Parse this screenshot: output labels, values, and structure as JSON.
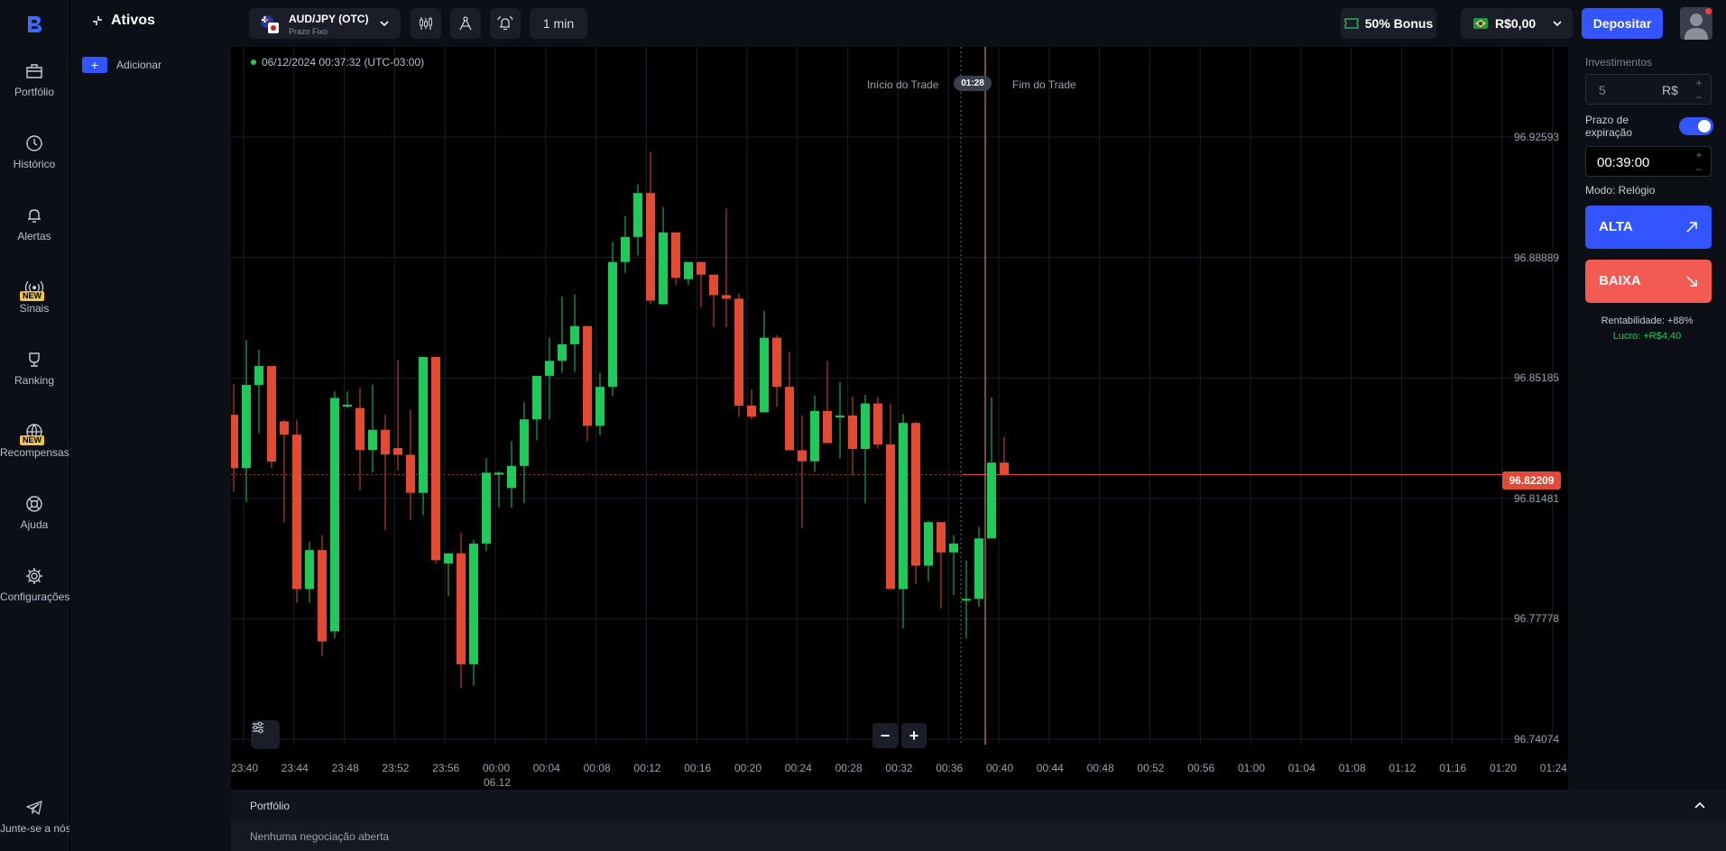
{
  "sidebar": {
    "logo": "brand-logo",
    "items": [
      {
        "label": "Portfólio",
        "icon": "briefcase-icon"
      },
      {
        "label": "Histórico",
        "icon": "clock-icon"
      },
      {
        "label": "Alertas",
        "icon": "bell-icon"
      },
      {
        "label": "Sinais",
        "icon": "signal-icon",
        "badge": "NEW"
      },
      {
        "label": "Ranking",
        "icon": "trophy-icon"
      },
      {
        "label": "Recompensas",
        "icon": "globe-icon",
        "badge": "NEW"
      },
      {
        "label": "Ajuda",
        "icon": "lifebuoy-icon"
      },
      {
        "label": "Configurações",
        "icon": "gear-icon"
      }
    ],
    "join": {
      "label": "Junte-se a nós",
      "icon": "telegram-icon"
    }
  },
  "assets_panel": {
    "title": "Ativos",
    "add_label": "Adicionar",
    "add_symbol": "+"
  },
  "topbar": {
    "asset": {
      "name": "AUD/JPY (OTC)",
      "subtitle": "Prazo Fixo"
    },
    "timeframe": "1 min",
    "bonus": "50% Bonus",
    "balance": "R$0,00",
    "deposit": "Depositar"
  },
  "chart": {
    "datetime": "06/12/2024 00:37:32 (UTC-03:00)",
    "trade_start": "Início do Trade",
    "trade_end": "Fim do Trade",
    "countdown": "01:28",
    "current_price": "96.82209",
    "y_ticks": [
      "96.92593",
      "96.88889",
      "96.85185",
      "96.81481",
      "96.77778",
      "96.74074"
    ],
    "x_ticks": [
      "23:40",
      "23:44",
      "23:48",
      "23:52",
      "23:56",
      "00:00",
      "00:04",
      "00:08",
      "00:12",
      "00:16",
      "00:20",
      "00:24",
      "00:28",
      "00:32",
      "00:36",
      "00:40",
      "00:44",
      "00:48",
      "00:52",
      "00:56",
      "01:00",
      "01:04",
      "01:08",
      "01:12",
      "01:16",
      "01:20",
      "01:24"
    ],
    "date_label": "06.12",
    "zoom_out": "−",
    "zoom_in": "+",
    "colors": {
      "up": "#21c85a",
      "down": "#e24a33",
      "grid": "#1b1e2a"
    },
    "candles": [
      [
        96.8405,
        96.85,
        96.8168,
        96.8241
      ],
      [
        96.8241,
        96.8635,
        96.8136,
        96.8497
      ],
      [
        96.8497,
        96.8604,
        96.8348,
        96.8555
      ],
      [
        96.8555,
        96.8555,
        96.8241,
        96.8261
      ],
      [
        96.8385,
        96.839,
        96.8075,
        96.8344
      ],
      [
        96.8344,
        96.839,
        96.7827,
        96.7869
      ],
      [
        96.7869,
        96.8014,
        96.7827,
        96.7989
      ],
      [
        96.7989,
        96.8035,
        96.7662,
        96.7708
      ],
      [
        96.7739,
        96.8477,
        96.7718,
        96.8457
      ],
      [
        96.8436,
        96.8477,
        96.8426,
        96.8436
      ],
      [
        96.8426,
        96.8488,
        96.8173,
        96.8297
      ],
      [
        96.8297,
        96.8498,
        96.8228,
        96.8359
      ],
      [
        96.8359,
        96.8405,
        96.8051,
        96.8283
      ],
      [
        96.8303,
        96.8573,
        96.8234,
        96.8282
      ],
      [
        96.8282,
        96.8421,
        96.8082,
        96.8165
      ],
      [
        96.8165,
        96.8447,
        96.8096,
        96.8583
      ],
      [
        96.8583,
        96.8583,
        96.7948,
        96.7958
      ],
      [
        96.7948,
        96.7979,
        96.7848,
        96.7979
      ],
      [
        96.7979,
        96.8043,
        96.7565,
        96.7638
      ],
      [
        96.7638,
        96.802,
        96.7572,
        96.8009
      ],
      [
        96.8009,
        96.8272,
        96.7987,
        96.8227
      ],
      [
        96.8227,
        96.8231,
        96.812,
        96.8227
      ],
      [
        96.818,
        96.8324,
        96.812,
        96.8248
      ],
      [
        96.8248,
        96.8444,
        96.8134,
        96.8391
      ],
      [
        96.8391,
        96.8524,
        96.8326,
        96.8525
      ],
      [
        96.8525,
        96.8643,
        96.8391,
        96.8571
      ],
      [
        96.8571,
        96.8768,
        96.8534,
        96.8622
      ],
      [
        96.8622,
        96.8775,
        96.8537,
        96.8678
      ],
      [
        96.8678,
        96.8678,
        96.8324,
        96.8371
      ],
      [
        96.8371,
        96.8534,
        96.8342,
        96.8491
      ],
      [
        96.8491,
        96.8936,
        96.8463,
        96.8875
      ],
      [
        96.8875,
        96.9016,
        96.8841,
        96.8952
      ],
      [
        96.8952,
        96.9114,
        96.8895,
        96.9087
      ],
      [
        96.9087,
        96.9214,
        96.8745,
        96.8756
      ],
      [
        96.8745,
        96.9044,
        96.8745,
        96.8966
      ],
      [
        96.8966,
        96.8946,
        96.8805,
        96.8826
      ],
      [
        96.8822,
        96.8862,
        96.8805,
        96.8875
      ],
      [
        96.8875,
        96.8836,
        96.8736,
        96.8836
      ],
      [
        96.8836,
        96.8821,
        96.8674,
        96.8773
      ],
      [
        96.8773,
        96.904,
        96.8675,
        96.8762
      ],
      [
        96.8762,
        96.8778,
        96.8399,
        96.8433
      ],
      [
        96.8433,
        96.8484,
        96.8391,
        96.8399
      ],
      [
        96.8413,
        96.8725,
        96.8413,
        96.8642
      ],
      [
        96.8642,
        96.865,
        96.843,
        96.8491
      ],
      [
        96.8491,
        96.8599,
        96.8325,
        96.8296
      ],
      [
        96.8296,
        96.8403,
        96.8056,
        96.8262
      ],
      [
        96.8262,
        96.8465,
        96.823,
        96.8417
      ],
      [
        96.8417,
        96.8571,
        96.8369,
        96.8318
      ],
      [
        96.8402,
        96.8505,
        96.8271,
        96.8403
      ],
      [
        96.8403,
        96.8461,
        96.8218,
        96.83
      ],
      [
        96.83,
        96.8466,
        96.8133,
        96.844
      ],
      [
        96.844,
        96.8459,
        96.8301,
        96.8314
      ],
      [
        96.8314,
        96.844,
        96.7871,
        96.7869
      ],
      [
        96.7869,
        96.8408,
        96.7747,
        96.838
      ],
      [
        96.838,
        96.8384,
        96.7884,
        96.7941
      ],
      [
        96.7941,
        96.8079,
        96.7893,
        96.8075
      ],
      [
        96.8075,
        96.8037,
        96.7809,
        96.7982
      ],
      [
        96.7982,
        96.8035,
        96.7851,
        96.8009
      ],
      [
        96.7839,
        96.7957,
        96.7718,
        96.7839
      ],
      [
        96.7839,
        96.806,
        96.7815,
        96.8025
      ],
      [
        96.8025,
        96.8458,
        96.8028,
        96.8258
      ],
      [
        96.8258,
        96.8338,
        96.8221,
        96.8221
      ]
    ]
  },
  "portfolio": {
    "title": "Portfólio",
    "empty": "Nenhuma negociação aberta"
  },
  "trade_panel": {
    "invest_label": "Investimentos",
    "invest_value": "5",
    "currency": "R$",
    "stepper_plus": "+",
    "stepper_minus": "−",
    "expiry_label": "Prazo de expiração",
    "expiry_time": "00:39:00",
    "mode": "Modo: Relógio",
    "buy_label": "ALTA",
    "sell_label": "BAIXA",
    "profitability": "Rentabilidade: +88%",
    "profit": "Lucro: +R$4,40",
    "buy_color": "#3355ff",
    "sell_color": "#f35a52"
  }
}
